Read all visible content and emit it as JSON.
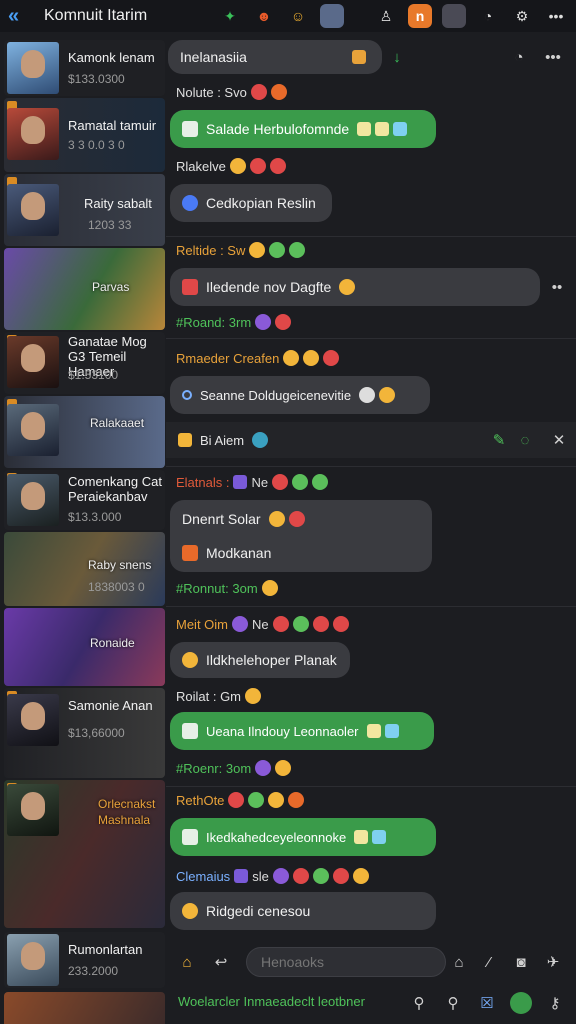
{
  "header": {
    "title": "Komnuit Itarim",
    "icons": [
      "back-icon",
      "sparkle-icon",
      "mask-icon",
      "face-icon",
      "avatar-icon",
      "person-icon",
      "tag-icon",
      "profile-icon",
      "clock-icon",
      "settings-icon",
      "more-icon"
    ]
  },
  "sidebar": {
    "items": [
      {
        "name": "Kamonk lenam",
        "sub": "$133.0300"
      },
      {
        "name": "Ramatal tamuir",
        "sub": "3 3 0.0 3 0"
      },
      {
        "name": "Raity sabalt",
        "sub": "1203 33"
      },
      {
        "name": "",
        "sub": "",
        "caption": "Parvas"
      },
      {
        "name": "Ganatae Mog G3 Temeil Hamaer",
        "sub": "$1:53100"
      },
      {
        "name": "",
        "sub": "",
        "caption": "Ralakaaet"
      },
      {
        "name": "Comenkang Cat Peraiekanbav",
        "sub": "$13.3.000"
      },
      {
        "name": "",
        "sub": "1838003 0",
        "caption": "Raby snens"
      },
      {
        "name": "",
        "sub": "",
        "caption": "Ronaide"
      },
      {
        "name": "Samonie Anan",
        "sub": "$13,66000"
      },
      {
        "name": "",
        "sub": "",
        "caption": "Orlecnakst Mashnala"
      },
      {
        "name": "Rumonlartan",
        "sub": "233.2000"
      }
    ]
  },
  "chat": {
    "top_bubble": "Inelanasiia",
    "messages": [
      {
        "user": "Nolute : Svo",
        "bubble": "Salade Herbulofomnde",
        "style": "green"
      },
      {
        "user": "Rlakelve",
        "bubble": "Cedkopian Reslin",
        "style": "gray"
      },
      {
        "user": "Reltide : Sw",
        "bubble": "Iledende nov Dagfte",
        "style": "gray"
      },
      {
        "user": "#Roand: 3rm",
        "bubble": "",
        "style": ""
      },
      {
        "user": "Rmaeder Creafen",
        "bubble": "Seanne Doldugeicenevitie",
        "style": "gray"
      },
      {
        "user": "",
        "bubble": "Bi Aiem",
        "style": "action"
      },
      {
        "user": "Elatnals :",
        "bubble": "Dnenrt Solar",
        "style": "gray",
        "bubble2": "Modkanan"
      },
      {
        "user": "#Ronnut: 3om",
        "bubble": "",
        "style": ""
      },
      {
        "user": "Meit Oim",
        "bubble": "Ildkhelehoper Planak",
        "style": "gray"
      },
      {
        "user": "Roilat : Gm",
        "bubble": "Ueana Ilndouy Leonnaoler",
        "style": "green"
      },
      {
        "user": "#Roenr: 3om",
        "bubble": "",
        "style": ""
      },
      {
        "user": "RethOte",
        "bubble": "Ikedkahedceyeleonnoke",
        "style": "green"
      },
      {
        "user": "Clemaius",
        "bubble": "Ridgedi cenesou",
        "style": "gray"
      }
    ]
  },
  "input": {
    "placeholder": "Henoaoks"
  },
  "bottom": {
    "text": "Woelarcler Inmaeadeclt leotbner"
  },
  "colors": {
    "accent_green": "#3a9b4a",
    "accent_blue": "#4a9ff5",
    "orange": "#e8a23a",
    "bg": "#1c1d21"
  }
}
